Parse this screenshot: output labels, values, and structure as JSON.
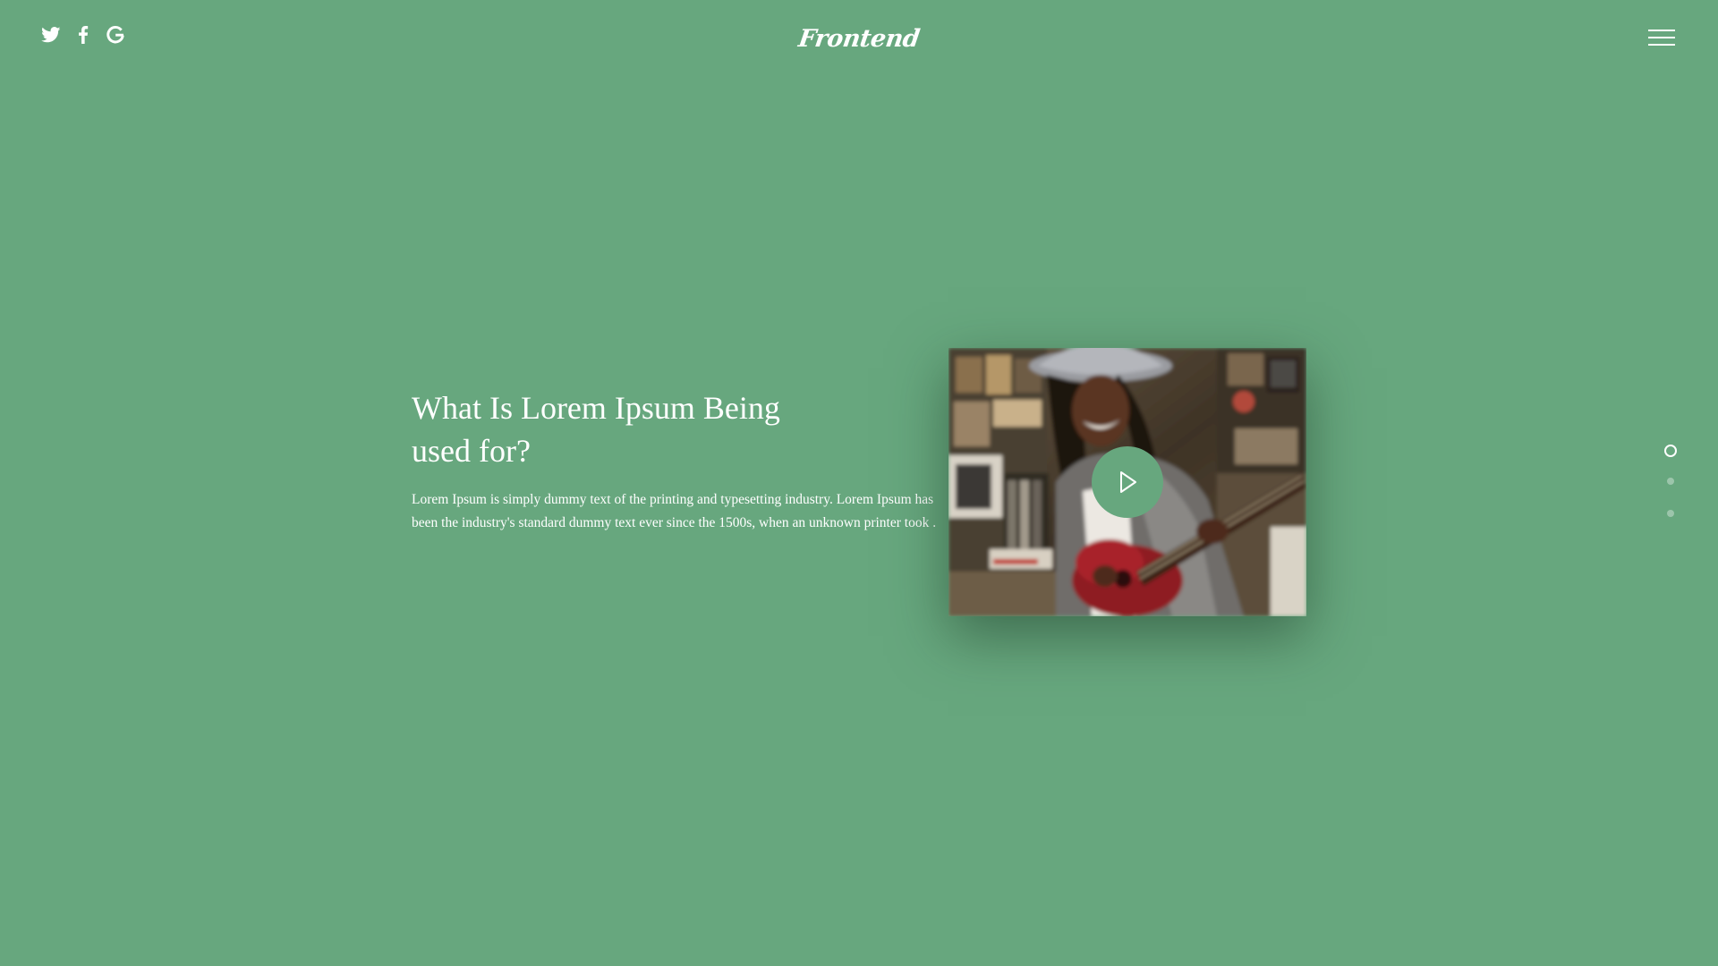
{
  "colors": {
    "background": "#67a77e",
    "text": "#ffffff",
    "play_button": "#67a77e"
  },
  "header": {
    "social_icons": [
      "twitter-icon",
      "facebook-icon",
      "google-icon"
    ],
    "logo_text": "Frontend",
    "menu_icon": "hamburger-menu-icon"
  },
  "hero": {
    "title": "What Is Lorem Ipsum Being used for?",
    "description": "Lorem Ipsum is simply dummy text of the printing and typesetting industry. Lorem Ipsum has been the industry's standard dummy text ever since the 1500s, when an unknown printer took ."
  },
  "video": {
    "thumbnail": "woman-playing-guitar-in-record-store",
    "play_icon": "play-icon"
  },
  "slider": {
    "total_slides": 3,
    "active_slide": 1
  }
}
